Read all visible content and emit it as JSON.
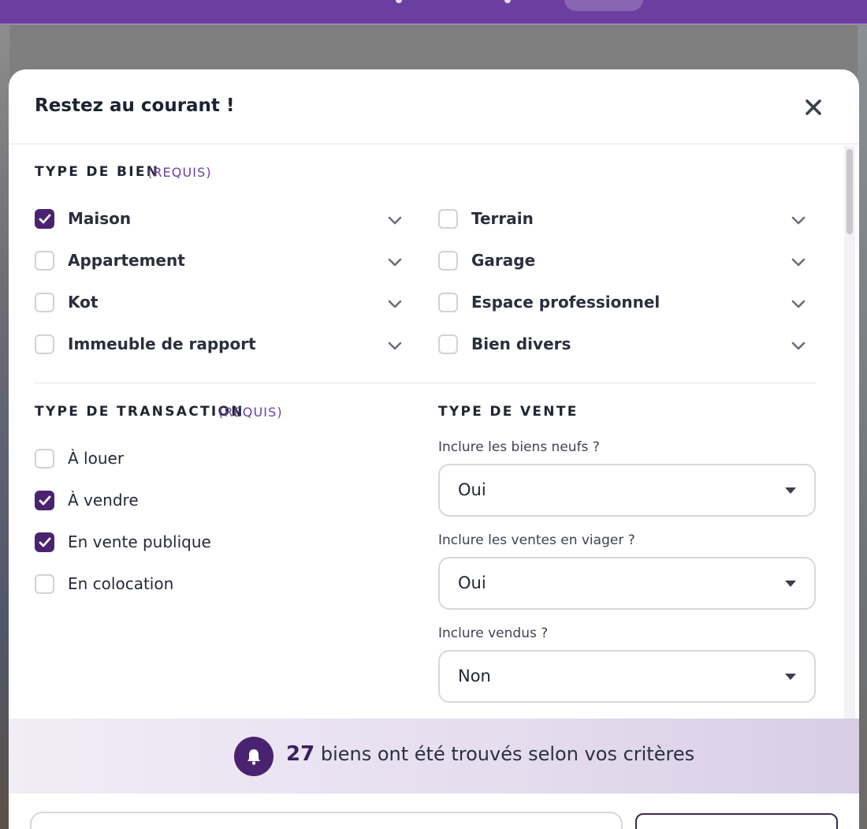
{
  "modal": {
    "title": "Restez au courant !"
  },
  "property_type": {
    "heading": "TYPE DE BIEN",
    "required": "(REQUIS)",
    "items": [
      {
        "label": "Maison",
        "checked": true
      },
      {
        "label": "Terrain",
        "checked": false
      },
      {
        "label": "Appartement",
        "checked": false
      },
      {
        "label": "Garage",
        "checked": false
      },
      {
        "label": "Kot",
        "checked": false
      },
      {
        "label": "Espace professionnel",
        "checked": false
      },
      {
        "label": "Immeuble de rapport",
        "checked": false
      },
      {
        "label": "Bien divers",
        "checked": false
      }
    ]
  },
  "transaction_type": {
    "heading": "TYPE DE TRANSACTION",
    "required": "(REQUIS)",
    "items": [
      {
        "label": "À louer",
        "checked": false
      },
      {
        "label": "À vendre",
        "checked": true
      },
      {
        "label": "En vente publique",
        "checked": true
      },
      {
        "label": "En colocation",
        "checked": false
      }
    ]
  },
  "sale_type": {
    "heading": "TYPE DE VENTE",
    "fields": [
      {
        "label": "Inclure les biens neufs ?",
        "value": "Oui"
      },
      {
        "label": "Inclure les ventes en viager ?",
        "value": "Oui"
      },
      {
        "label": "Inclure vendus ?",
        "value": "Non"
      }
    ]
  },
  "results": {
    "count": "27",
    "text": "biens ont été trouvés selon vos critères"
  },
  "colors": {
    "brand": "#6b3fa0",
    "checked": "#4a2370"
  }
}
